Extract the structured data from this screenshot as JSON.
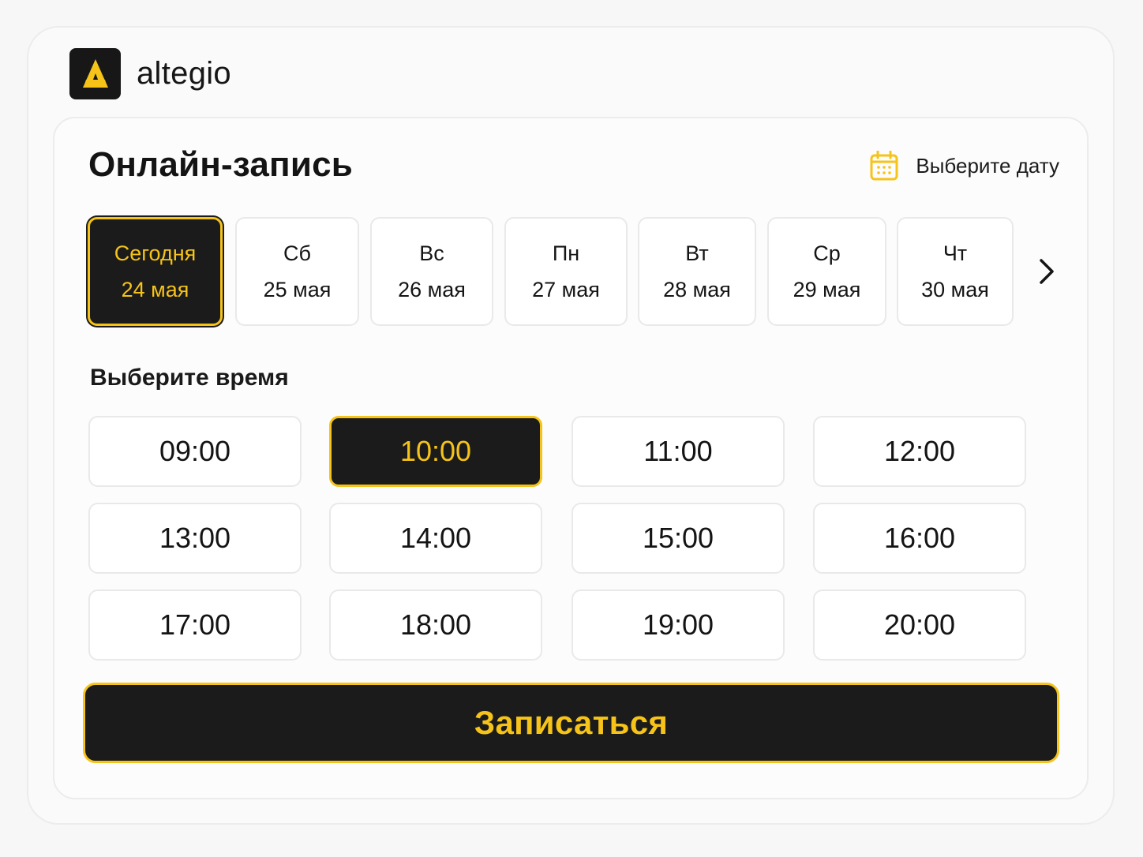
{
  "brand": {
    "name": "altegio",
    "logo_icon": "altegio-a-logo-icon",
    "colors": {
      "logo_bg": "#171717",
      "logo_glyph": "#f6c319"
    }
  },
  "booking": {
    "title": "Онлайн-запись",
    "date_picker": {
      "label": "Выберите дату",
      "icon": "calendar-icon"
    },
    "days": [
      {
        "name": "Сегодня",
        "date": "24 мая",
        "selected": true
      },
      {
        "name": "Сб",
        "date": "25 мая",
        "selected": false
      },
      {
        "name": "Вс",
        "date": "26 мая",
        "selected": false
      },
      {
        "name": "Пн",
        "date": "27 мая",
        "selected": false
      },
      {
        "name": "Вт",
        "date": "28 мая",
        "selected": false
      },
      {
        "name": "Ср",
        "date": "29 мая",
        "selected": false
      },
      {
        "name": "Чт",
        "date": "30 мая",
        "selected": false
      }
    ],
    "next_days_icon": "chevron-right-icon",
    "time_heading": "Выберите время",
    "times": [
      "09:00",
      "10:00",
      "11:00",
      "12:00",
      "13:00",
      "14:00",
      "15:00",
      "16:00",
      "17:00",
      "18:00",
      "19:00",
      "20:00"
    ],
    "selected_time": "10:00",
    "submit_label": "Записаться"
  },
  "colors": {
    "accent": "#f6c319",
    "dark": "#1b1b1b",
    "tile_border": "#e9e9e9",
    "page_bg": "#f7f7f7"
  }
}
